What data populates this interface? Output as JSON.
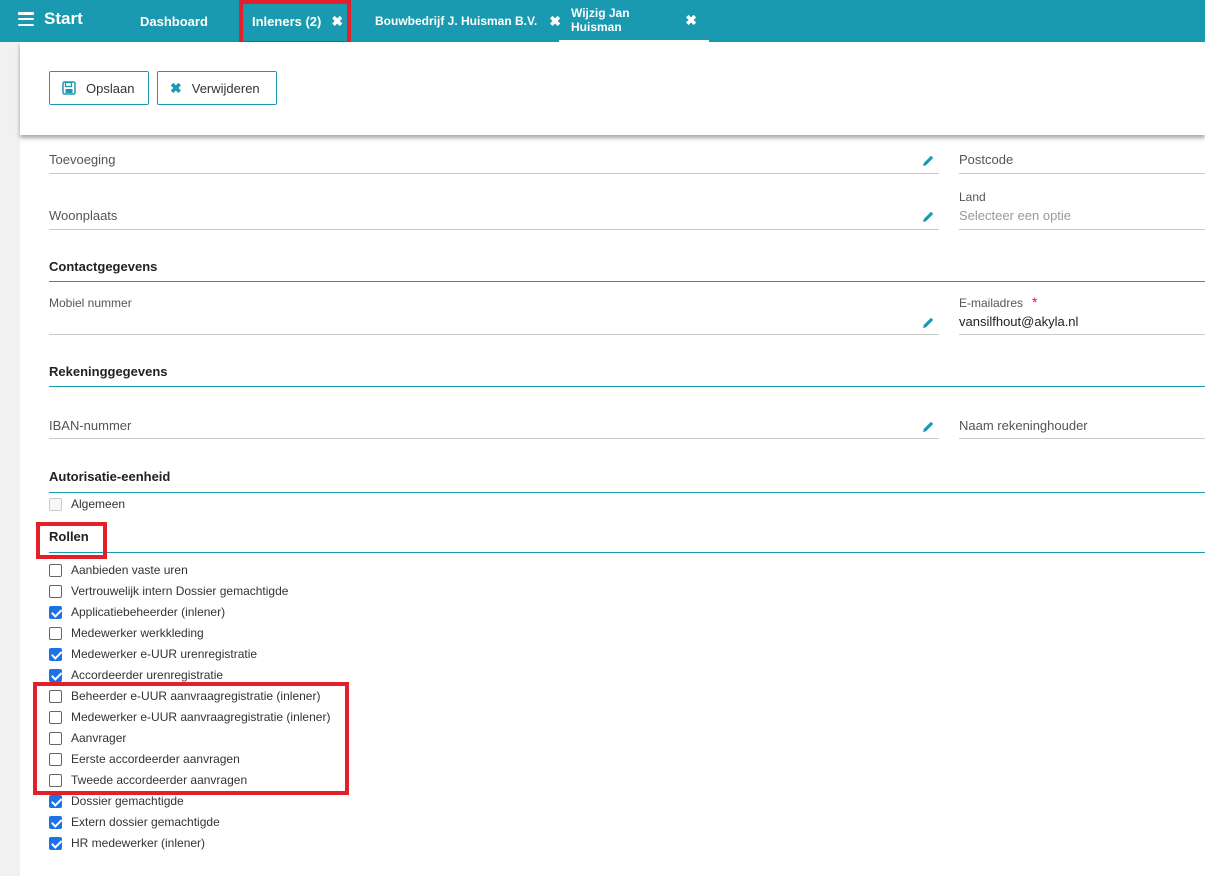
{
  "nav": {
    "start_label": "Start",
    "tabs": [
      {
        "label": "Dashboard",
        "closable": false
      },
      {
        "label": "Inleners (2)",
        "closable": true
      },
      {
        "label": "Bouwbedrijf J. Huisman B.V.",
        "closable": true
      },
      {
        "label": "Wijzig Jan Huisman",
        "closable": true,
        "active": true
      }
    ],
    "close_glyph": "✖"
  },
  "toolbar": {
    "save_label": "Opslaan",
    "delete_label": "Verwijderen"
  },
  "form": {
    "toevoeging": {
      "label": "Toevoeging",
      "value": ""
    },
    "postcode": {
      "label": "Postcode",
      "value": ""
    },
    "woonplaats": {
      "label": "Woonplaats",
      "value": ""
    },
    "land": {
      "label": "Land",
      "placeholder": "Selecteer een optie"
    },
    "contact_section": "Contactgegevens",
    "mobiel": {
      "label": "Mobiel nummer",
      "value": ""
    },
    "email": {
      "label": "E-mailadres",
      "required_mark": "*",
      "value": "vansilfhout@akyla.nl"
    },
    "rekening_section": "Rekeninggegevens",
    "iban": {
      "label": "IBAN-nummer",
      "value": ""
    },
    "rekeninghouder": {
      "label": "Naam rekeninghouder",
      "value": ""
    },
    "autorisatie_section": "Autorisatie-eenheid",
    "autorisatie_items": [
      {
        "label": "Algemeen",
        "checked": false,
        "disabled": true
      }
    ],
    "rollen_section": "Rollen",
    "rollen": [
      {
        "label": "Aanbieden vaste uren",
        "checked": false
      },
      {
        "label": "Vertrouwelijk intern Dossier gemachtigde",
        "checked": false
      },
      {
        "label": "Applicatiebeheerder (inlener)",
        "checked": true
      },
      {
        "label": "Medewerker werkkleding",
        "checked": false
      },
      {
        "label": "Medewerker e-UUR urenregistratie",
        "checked": true
      },
      {
        "label": "Accordeerder urenregistratie",
        "checked": true
      },
      {
        "label": "Beheerder e-UUR aanvraagregistratie (inlener)",
        "checked": false
      },
      {
        "label": "Medewerker e-UUR aanvraagregistratie (inlener)",
        "checked": false
      },
      {
        "label": "Aanvrager",
        "checked": false
      },
      {
        "label": "Eerste accordeerder aanvragen",
        "checked": false
      },
      {
        "label": "Tweede accordeerder aanvragen",
        "checked": false
      },
      {
        "label": "Dossier gemachtigde",
        "checked": true
      },
      {
        "label": "Extern dossier gemachtigde",
        "checked": true
      },
      {
        "label": "HR medewerker (inlener)",
        "checked": true
      }
    ]
  },
  "colors": {
    "accent": "#1a9ab0",
    "highlight": "#e3202a",
    "checkbox": "#1a73e8"
  }
}
